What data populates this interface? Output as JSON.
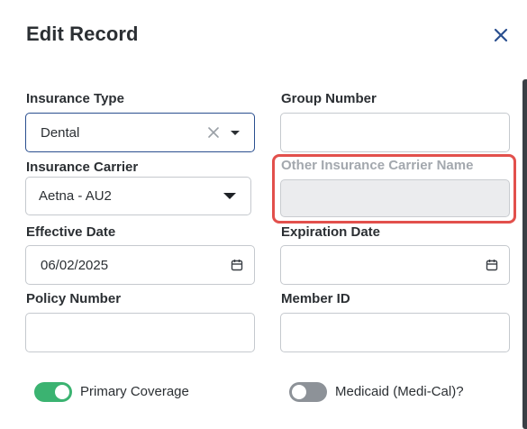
{
  "dialog": {
    "title": "Edit Record",
    "close_icon": "close-icon"
  },
  "form": {
    "insurance_type": {
      "label": "Insurance Type",
      "value": "Dental"
    },
    "group_number": {
      "label": "Group Number",
      "value": ""
    },
    "insurance_carrier": {
      "label": "Insurance Carrier",
      "value": "Aetna - AU2"
    },
    "other_carrier_name": {
      "label": "Other Insurance Carrier Name",
      "value": ""
    },
    "effective_date": {
      "label": "Effective Date",
      "value": "06/02/2025"
    },
    "expiration_date": {
      "label": "Expiration Date",
      "value": ""
    },
    "policy_number": {
      "label": "Policy Number",
      "value": ""
    },
    "member_id": {
      "label": "Member ID",
      "value": ""
    }
  },
  "toggles": {
    "primary_coverage": {
      "label": "Primary Coverage",
      "on": true
    },
    "medicaid": {
      "label": "Medicaid (Medi-Cal)?",
      "on": false
    }
  },
  "colors": {
    "focus_border": "#2a4f8f",
    "highlight": "#e2504c",
    "toggle_on": "#3bb371",
    "toggle_off": "#8d9298",
    "close_icon": "#2a4f8f"
  }
}
